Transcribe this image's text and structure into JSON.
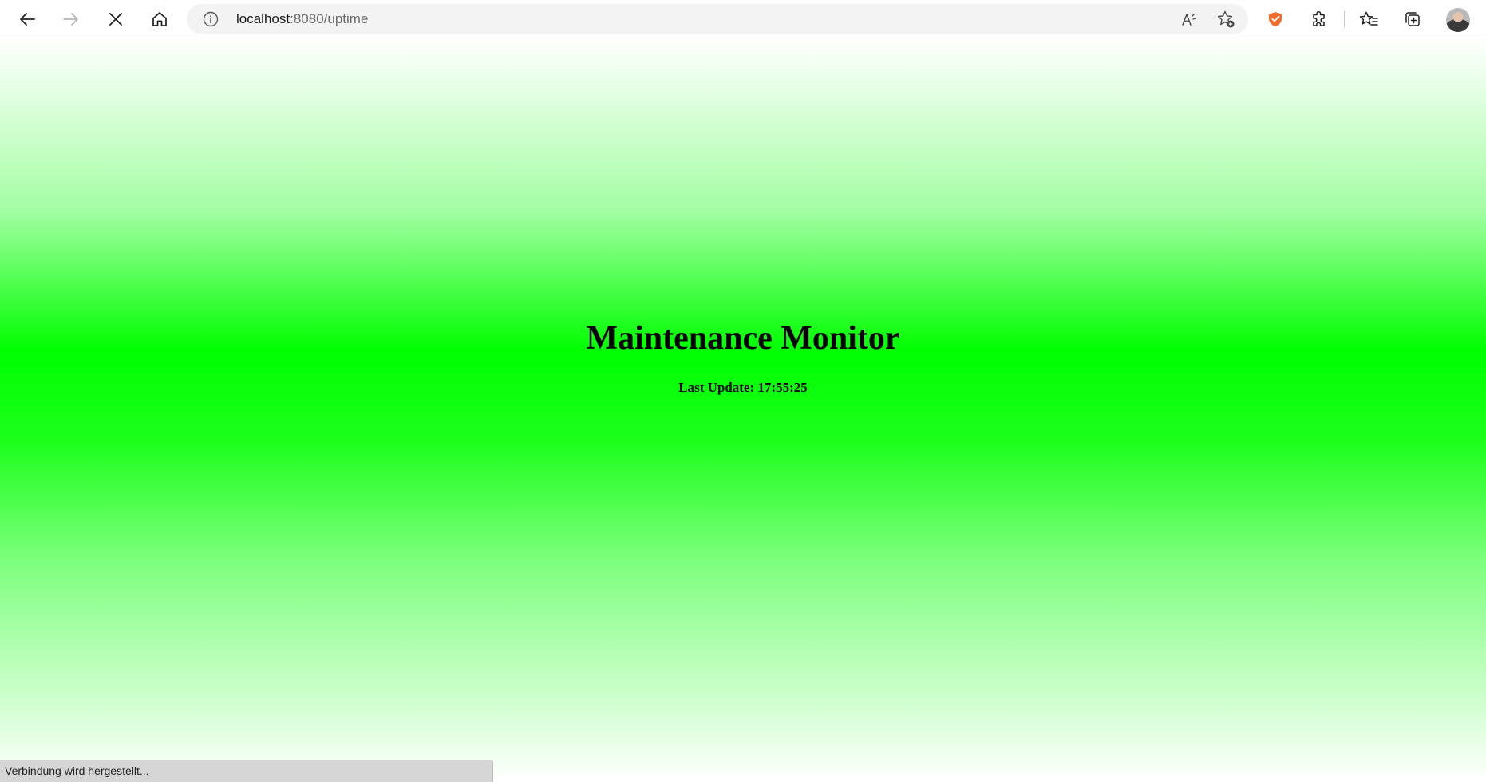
{
  "browser": {
    "url_host": "localhost",
    "url_rest": ":8080/uptime",
    "icons": {
      "back": "arrow-left-icon",
      "forward": "arrow-right-icon",
      "stop": "close-icon",
      "home": "home-icon",
      "site_info": "info-icon",
      "read_aloud": "read-aloud-icon",
      "add_favorite": "star-add-icon",
      "extension_shield": "shield-icon",
      "extensions": "puzzle-icon",
      "favorites": "favorites-icon",
      "collections": "collections-icon",
      "profile": "avatar"
    },
    "status_text": "Verbindung wird hergestellt..."
  },
  "page": {
    "title": "Maintenance Monitor",
    "last_update": "Last Update: 17:55:25",
    "colors": {
      "status_green": "#00ff00",
      "fade": "#ffffff"
    }
  }
}
